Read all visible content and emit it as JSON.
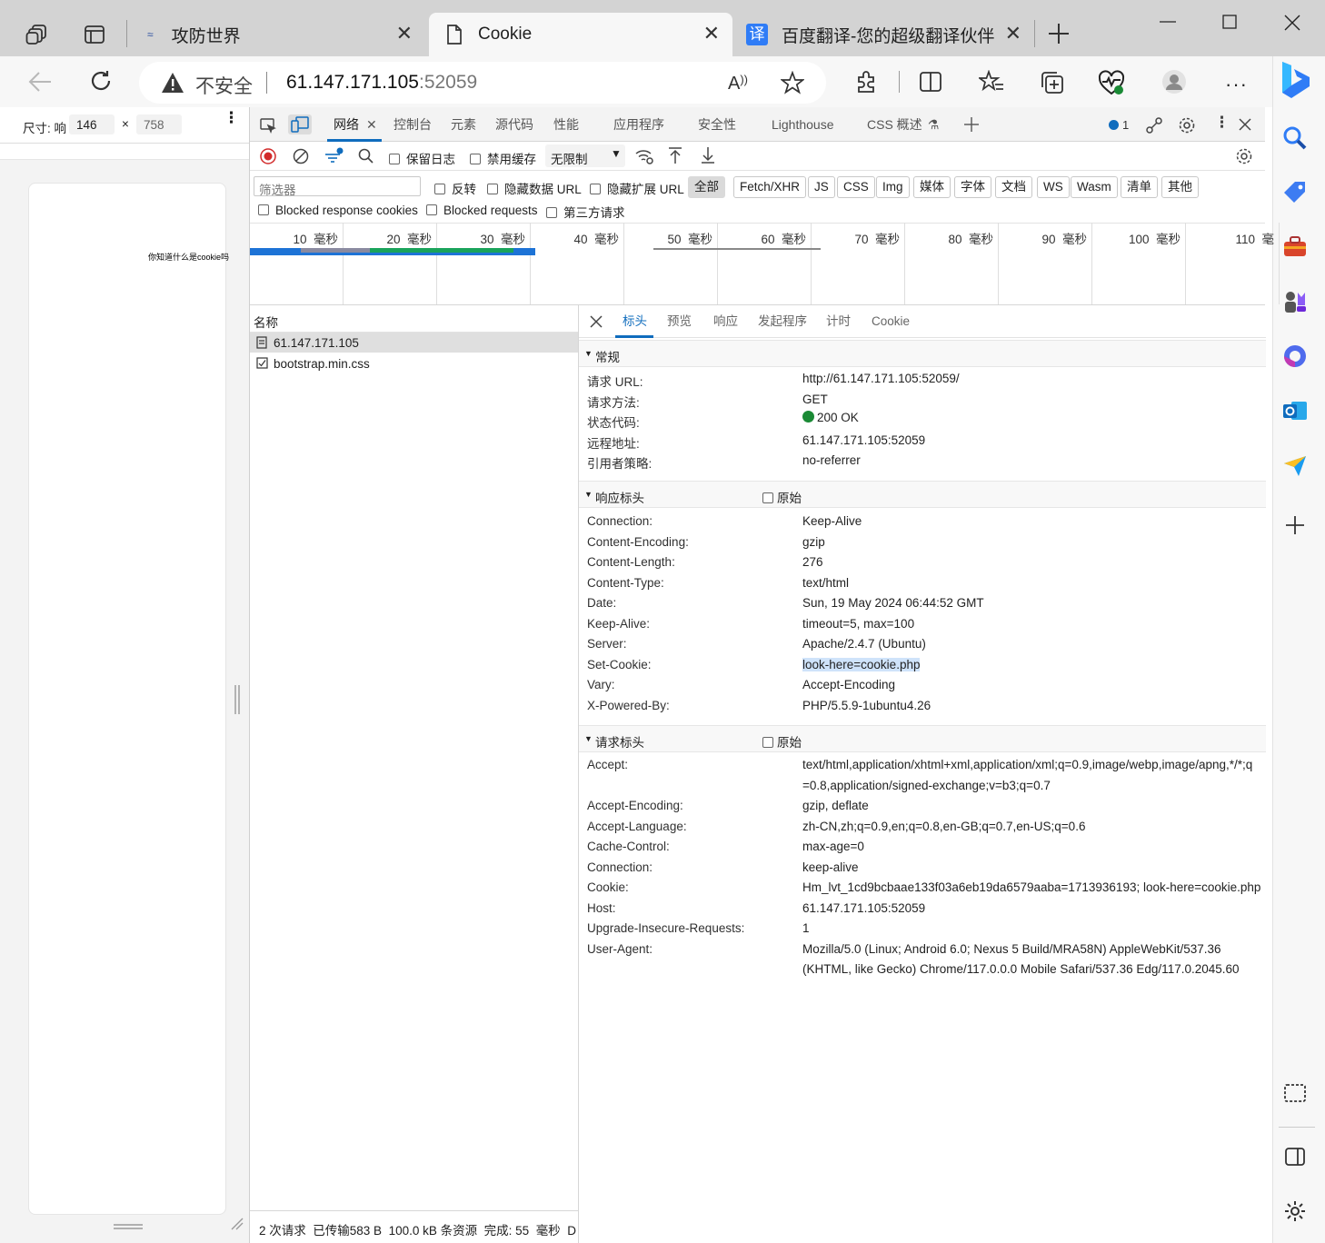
{
  "tabs": [
    {
      "title": "攻防世界"
    },
    {
      "title": "Cookie"
    },
    {
      "title": "百度翻译-您的超级翻译伙伴"
    }
  ],
  "badge_translate": "译",
  "address": {
    "warning": "不安全",
    "host": "61.147.171.105",
    "port": ":52059"
  },
  "device": {
    "label": "尺寸: 响",
    "width": "146",
    "x": "×",
    "height": "758"
  },
  "page_text": "你知道什么是cookie吗",
  "devtools": {
    "tabs": [
      "网络",
      "控制台",
      "元素",
      "源代码",
      "性能",
      "应用程序",
      "安全性",
      "Lighthouse",
      "CSS 概述"
    ],
    "issue_count": "1",
    "toolbar": {
      "preserve_log": "保留日志",
      "disable_cache": "禁用缓存",
      "throttle": "无限制"
    },
    "filter": {
      "placeholder": "筛选器",
      "invert": "反转",
      "hide_data_url": "隐藏数据 URL",
      "hide_ext_url": "隐藏扩展 URL"
    },
    "types": [
      "全部",
      "Fetch/XHR",
      "JS",
      "CSS",
      "Img",
      "媒体",
      "字体",
      "文档",
      "WS",
      "Wasm",
      "清单",
      "其他"
    ],
    "row3": {
      "blocked_cookies": "Blocked response cookies",
      "blocked_requests": "Blocked requests",
      "third_party": "第三方请求"
    },
    "timeline_ticks": [
      {
        "n": "10",
        "u": "毫秒"
      },
      {
        "n": "20",
        "u": "毫秒"
      },
      {
        "n": "30",
        "u": "毫秒"
      },
      {
        "n": "40",
        "u": "毫秒"
      },
      {
        "n": "50",
        "u": "毫秒"
      },
      {
        "n": "60",
        "u": "毫秒"
      },
      {
        "n": "70",
        "u": "毫秒"
      },
      {
        "n": "80",
        "u": "毫秒"
      },
      {
        "n": "90",
        "u": "毫秒"
      },
      {
        "n": "100",
        "u": "毫秒"
      },
      {
        "n": "110",
        "u": "毫"
      }
    ],
    "name_header": "名称",
    "requests": [
      "61.147.171.105",
      "bootstrap.min.css"
    ],
    "status_bar": {
      "requests": "2 次请求",
      "transferred": "已传输583 B",
      "resources": "100.0 kB 条资源",
      "finish": "完成: 55",
      "unit": "毫秒",
      "tail": "D"
    },
    "detail_tabs": [
      "标头",
      "预览",
      "响应",
      "发起程序",
      "计时",
      "Cookie"
    ],
    "general": {
      "title": "常规",
      "rows": [
        {
          "k": "请求 URL:",
          "v": "http://61.147.171.105:52059/"
        },
        {
          "k": "请求方法:",
          "v": "GET"
        },
        {
          "k": "状态代码:",
          "v": "200 OK"
        },
        {
          "k": "远程地址:",
          "v": "61.147.171.105:52059"
        },
        {
          "k": "引用者策略:",
          "v": "no-referrer"
        }
      ]
    },
    "response_headers": {
      "title": "响应标头",
      "raw": "原始",
      "rows": [
        {
          "k": "Connection:",
          "v": "Keep-Alive"
        },
        {
          "k": "Content-Encoding:",
          "v": "gzip"
        },
        {
          "k": "Content-Length:",
          "v": "276"
        },
        {
          "k": "Content-Type:",
          "v": "text/html"
        },
        {
          "k": "Date:",
          "v": "Sun, 19 May 2024 06:44:52 GMT"
        },
        {
          "k": "Keep-Alive:",
          "v": "timeout=5, max=100"
        },
        {
          "k": "Server:",
          "v": "Apache/2.4.7 (Ubuntu)"
        },
        {
          "k": "Set-Cookie:",
          "v": "look-here=cookie.php"
        },
        {
          "k": "Vary:",
          "v": "Accept-Encoding"
        },
        {
          "k": "X-Powered-By:",
          "v": "PHP/5.5.9-1ubuntu4.26"
        }
      ]
    },
    "request_headers": {
      "title": "请求标头",
      "raw": "原始",
      "accept_k": "Accept:",
      "accept_v1": "text/html,application/xhtml+xml,application/xml;q=0.9,image/webp,image/apng,*/*;q",
      "accept_v2": "=0.8,application/signed-exchange;v=b3;q=0.7",
      "rows": [
        {
          "k": "Accept-Encoding:",
          "v": "gzip, deflate"
        },
        {
          "k": "Accept-Language:",
          "v": "zh-CN,zh;q=0.9,en;q=0.8,en-GB;q=0.7,en-US;q=0.6"
        },
        {
          "k": "Cache-Control:",
          "v": "max-age=0"
        },
        {
          "k": "Connection:",
          "v": "keep-alive"
        },
        {
          "k": "Cookie:",
          "v": "Hm_lvt_1cd9bcbaae133f03a6eb19da6579aaba=1713936193; look-here=cookie.php"
        },
        {
          "k": "Host:",
          "v": "61.147.171.105:52059"
        },
        {
          "k": "Upgrade-Insecure-Requests:",
          "v": "1"
        }
      ],
      "ua_k": "User-Agent:",
      "ua_v1": "Mozilla/5.0 (Linux; Android 6.0; Nexus 5 Build/MRA58N) AppleWebKit/537.36",
      "ua_v2": "(KHTML, like Gecko) Chrome/117.0.0.0 Mobile Safari/537.36 Edg/117.0.2045.60"
    }
  },
  "colors": {
    "accent": "#0f6cbd",
    "status_ok": "#1a8a35",
    "highlight": "#cfe3fa",
    "record": "#d22b2b"
  }
}
